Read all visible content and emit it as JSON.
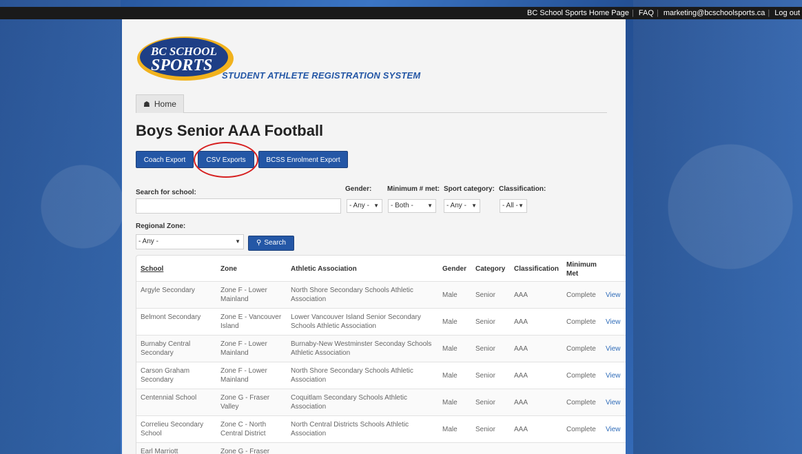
{
  "top_nav": {
    "links": [
      "BC School Sports Home Page",
      "FAQ",
      "marketing@bcschoolsports.ca",
      "Log out"
    ]
  },
  "logo": {
    "line1": "BC SCHOOL",
    "line2": "SPORTS",
    "subtitle": "STUDENT ATHLETE REGISTRATION SYSTEM"
  },
  "home_tab": {
    "label": "Home"
  },
  "page_title": "Boys Senior AAA Football",
  "actions": {
    "coach_export": "Coach Export",
    "csv_exports": "CSV Exports",
    "bcss_enrolment_export": "BCSS Enrolment Export"
  },
  "filters": {
    "search_label": "Search for school:",
    "gender_label": "Gender:",
    "gender_value": "- Any -",
    "minimum_label": "Minimum # met:",
    "minimum_value": "- Both -",
    "sport_category_label": "Sport category:",
    "sport_category_value": "- Any -",
    "classification_label": "Classification:",
    "classification_value": "- All -",
    "regional_zone_label": "Regional Zone:",
    "regional_zone_value": "- Any -",
    "search_button": "Search"
  },
  "table": {
    "headers": [
      "School",
      "Zone",
      "Athletic Association",
      "Gender",
      "Category",
      "Classification",
      "Minimum Met"
    ],
    "rows": [
      {
        "school": "Argyle Secondary",
        "zone": "Zone F - Lower Mainland",
        "association": "North Shore Secondary Schools Athletic Association",
        "gender": "Male",
        "category": "Senior",
        "classification": "AAA",
        "minimum": "Complete",
        "action": "View"
      },
      {
        "school": "Belmont Secondary",
        "zone": "Zone E - Vancouver Island",
        "association": "Lower Vancouver Island Senior Secondary Schools Athletic Association",
        "gender": "Male",
        "category": "Senior",
        "classification": "AAA",
        "minimum": "Complete",
        "action": "View"
      },
      {
        "school": "Burnaby Central Secondary",
        "zone": "Zone F - Lower Mainland",
        "association": "Burnaby-New Westminster Seconday Schools Athletic Association",
        "gender": "Male",
        "category": "Senior",
        "classification": "AAA",
        "minimum": "Complete",
        "action": "View"
      },
      {
        "school": "Carson Graham Secondary",
        "zone": "Zone F - Lower Mainland",
        "association": "North Shore Secondary Schools Athletic Association",
        "gender": "Male",
        "category": "Senior",
        "classification": "AAA",
        "minimum": "Complete",
        "action": "View"
      },
      {
        "school": "Centennial School",
        "zone": "Zone G - Fraser Valley",
        "association": "Coquitlam Secondary Schools Athletic Association",
        "gender": "Male",
        "category": "Senior",
        "classification": "AAA",
        "minimum": "Complete",
        "action": "View"
      },
      {
        "school": "Correlieu Secondary School",
        "zone": "Zone C - North Central District",
        "association": "North Central Districts Schools Athletic Association",
        "gender": "Male",
        "category": "Senior",
        "classification": "AAA",
        "minimum": "Complete",
        "action": "View"
      },
      {
        "school": "Earl Marriott",
        "zone": "Zone G - Fraser",
        "association": "",
        "gender": "",
        "category": "",
        "classification": "",
        "minimum": "",
        "action": ""
      }
    ]
  }
}
